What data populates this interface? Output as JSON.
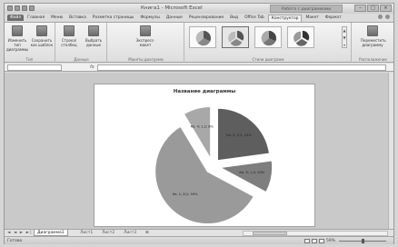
{
  "window": {
    "title": "Книга1 - Microsoft Excel",
    "context_tab_group": "Работа с диаграммами",
    "controls": [
      "–",
      "□",
      "×"
    ]
  },
  "tabs": [
    {
      "label": "Файл",
      "type": "file"
    },
    {
      "label": "Главная"
    },
    {
      "label": "Меню"
    },
    {
      "label": "Вставка"
    },
    {
      "label": "Разметка страницы"
    },
    {
      "label": "Формулы"
    },
    {
      "label": "Данные"
    },
    {
      "label": "Рецензирование"
    },
    {
      "label": "Вид"
    },
    {
      "label": "Office Tab"
    },
    {
      "label": "Конструктор",
      "active": true
    },
    {
      "label": "Макет"
    },
    {
      "label": "Формат"
    }
  ],
  "ribbon": {
    "type_group": {
      "label": "Тип",
      "buttons": [
        "Изменить тип диаграммы",
        "Сохранить как шаблон"
      ]
    },
    "data_group": {
      "label": "Данные",
      "buttons": [
        "Строка/столбец",
        "Выбрать данные"
      ]
    },
    "layouts_group": {
      "label": "Макеты диаграмм",
      "buttons": [
        "Экспресс-макет"
      ]
    },
    "styles_group": {
      "label": "Стили диаграмм",
      "count": 4,
      "selected_index": 1
    },
    "location_group": {
      "label": "Расположение",
      "buttons": [
        "Переместить диаграмму"
      ]
    }
  },
  "formula_bar": {
    "fx": "fx",
    "name_box": "",
    "value": ""
  },
  "chart": {
    "title": "Название диаграммы",
    "slice_labels": [
      "Кв. 1; 8,2; 59%",
      "Кв. 2; 3,2; 23%",
      "Кв. 3; 1,4; 10%",
      "Кв. 4; 1,2; 8%"
    ]
  },
  "chart_data": {
    "type": "pie",
    "title": "Название диаграммы",
    "categories": [
      "Кв. 1",
      "Кв. 2",
      "Кв. 3",
      "Кв. 4"
    ],
    "values": [
      8.2,
      3.2,
      1.4,
      1.2
    ],
    "colors": [
      "#9a9a9a",
      "#5e5e5e",
      "#7e7e7e",
      "#a8a8a8"
    ],
    "exploded": true
  },
  "sheets": {
    "nav": "◄ ◄ ► ►|",
    "tabs": [
      "Диаграмма1",
      "Лист1",
      "Лист2",
      "Лист3"
    ],
    "active_index": 0
  },
  "status": {
    "text": "Готово",
    "zoom": "59%"
  }
}
